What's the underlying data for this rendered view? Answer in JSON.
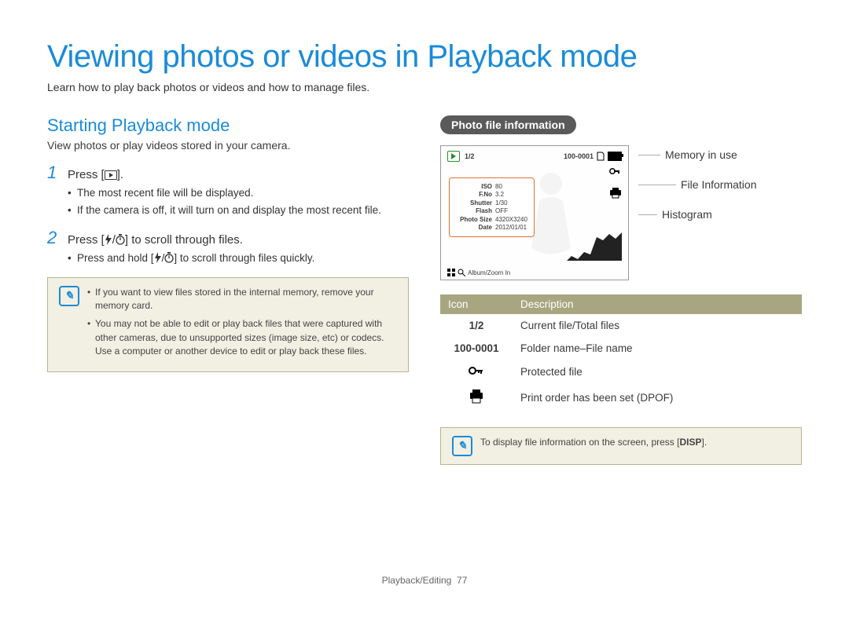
{
  "page": {
    "title": "Viewing photos or videos in Playback mode",
    "subtitle": "Learn how to play back photos or videos and how to manage files.",
    "footer_section": "Playback/Editing",
    "footer_page": "77"
  },
  "left": {
    "section_heading": "Starting Playback mode",
    "section_desc": "View photos or play videos stored in your camera.",
    "step1_prefix": "Press [",
    "step1_suffix": "].",
    "step1_bullets": [
      "The most recent file will be displayed.",
      "If the camera is off, it will turn on and display the most recent file."
    ],
    "step2_prefix": "Press [",
    "step2_mid": "/",
    "step2_suffix": "] to scroll through files.",
    "step2_bullet_prefix": "Press and hold [",
    "step2_bullet_mid": "/",
    "step2_bullet_suffix": "] to scroll through files quickly.",
    "note_items": [
      "If you want to view files stored in the internal memory, remove your memory card.",
      "You may not be able to edit or play back files that were captured with other cameras, due to unsupported sizes (image size, etc) or codecs. Use a computer or another device to edit or play back these files."
    ]
  },
  "right": {
    "pill_label": "Photo file information",
    "screen": {
      "counter": "1/2",
      "folder_file": "100-0001",
      "info_rows": [
        {
          "label": "ISO",
          "value": "80"
        },
        {
          "label": "F.No",
          "value": "3.2"
        },
        {
          "label": "Shutter",
          "value": "1/30"
        },
        {
          "label": "Flash",
          "value": "OFF"
        },
        {
          "label": "Photo Size",
          "value": "4320X3240"
        },
        {
          "label": "Date",
          "value": "2012/01/01"
        }
      ],
      "bottom_hint": "Album/Zoom In"
    },
    "callouts": {
      "memory": "Memory in use",
      "fileinfo": "File Information",
      "histogram": "Histogram"
    },
    "table": {
      "head_icon": "Icon",
      "head_desc": "Description",
      "rows": [
        {
          "icon_text": "1/2",
          "desc": "Current file/Total files",
          "icon_type": "text"
        },
        {
          "icon_text": "100-0001",
          "desc": "Folder name–File name",
          "icon_type": "text"
        },
        {
          "icon_text": "",
          "desc": "Protected file",
          "icon_type": "key"
        },
        {
          "icon_text": "",
          "desc": "Print order has been set (DPOF)",
          "icon_type": "printer"
        }
      ]
    },
    "tip_prefix": "To display file information on the screen, press [",
    "tip_keyword": "DISP",
    "tip_suffix": "]."
  }
}
